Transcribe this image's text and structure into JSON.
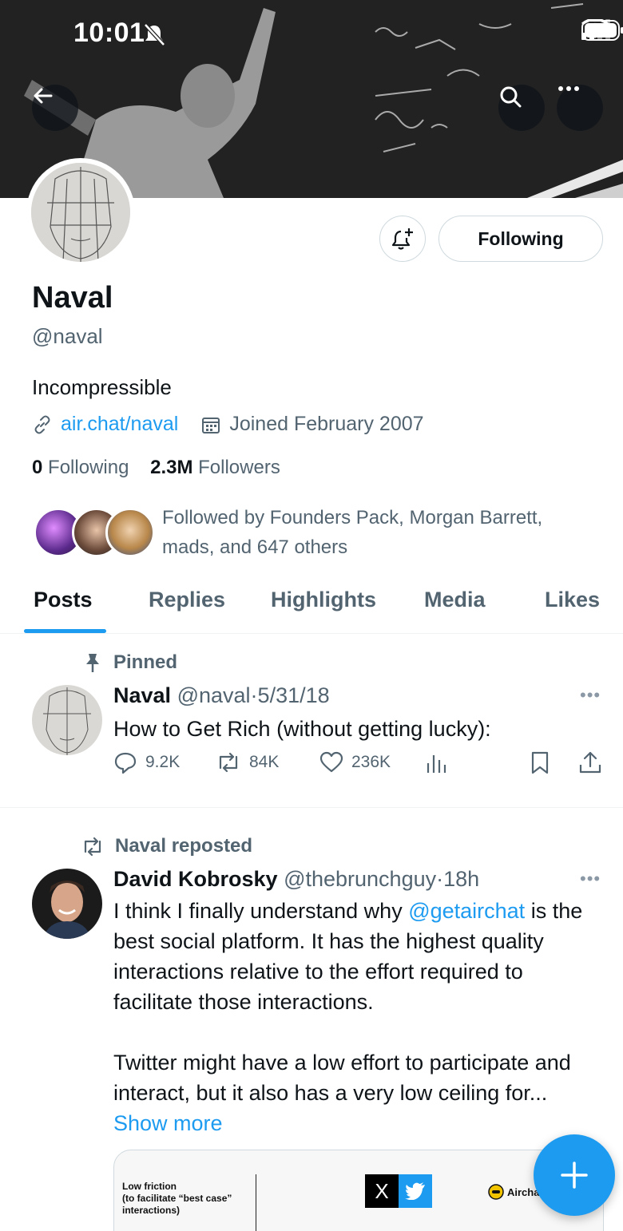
{
  "status_bar": {
    "time": "10:01"
  },
  "profile": {
    "name": "Naval",
    "handle": "@naval",
    "bio": "Incompressible",
    "link": "air.chat/naval",
    "joined": "Joined February 2007",
    "following_count": "0",
    "following_label": "Following",
    "followers_count": "2.3M",
    "followers_label": "Followers",
    "followed_by": "Followed by Founders Pack, Morgan Barrett, mads, and 647 others",
    "following_button": "Following"
  },
  "tabs": [
    {
      "label": "Posts",
      "active": true
    },
    {
      "label": "Replies"
    },
    {
      "label": "Highlights"
    },
    {
      "label": "Media"
    },
    {
      "label": "Likes"
    }
  ],
  "posts": [
    {
      "context": "Pinned",
      "author": "Naval",
      "handle": "@naval",
      "date": "5/31/18",
      "text": "How to Get Rich (without getting lucky):",
      "replies": "9.2K",
      "reposts": "84K",
      "likes": "236K"
    },
    {
      "context": "Naval reposted",
      "author": "David Kobrosky",
      "handle": "@thebrunchguy",
      "date": "18h",
      "text_part1": "I think I finally understand why ",
      "mention": "@getairchat",
      "text_part2": " is the best social platform. It has the highest quality interactions relative to the effort required to facilitate those interactions.",
      "text_para2": "Twitter might have a low effort to participate and interact, but it also has a very low ceiling for...",
      "show_more": "Show more",
      "card": {
        "left_text": "Low friction\n(to facilitate “best case”\n interactions)",
        "x_letter": "X",
        "airchat_label": "Aircha"
      }
    }
  ],
  "colors": {
    "accent": "#1d9bf0",
    "muted": "#536471"
  }
}
